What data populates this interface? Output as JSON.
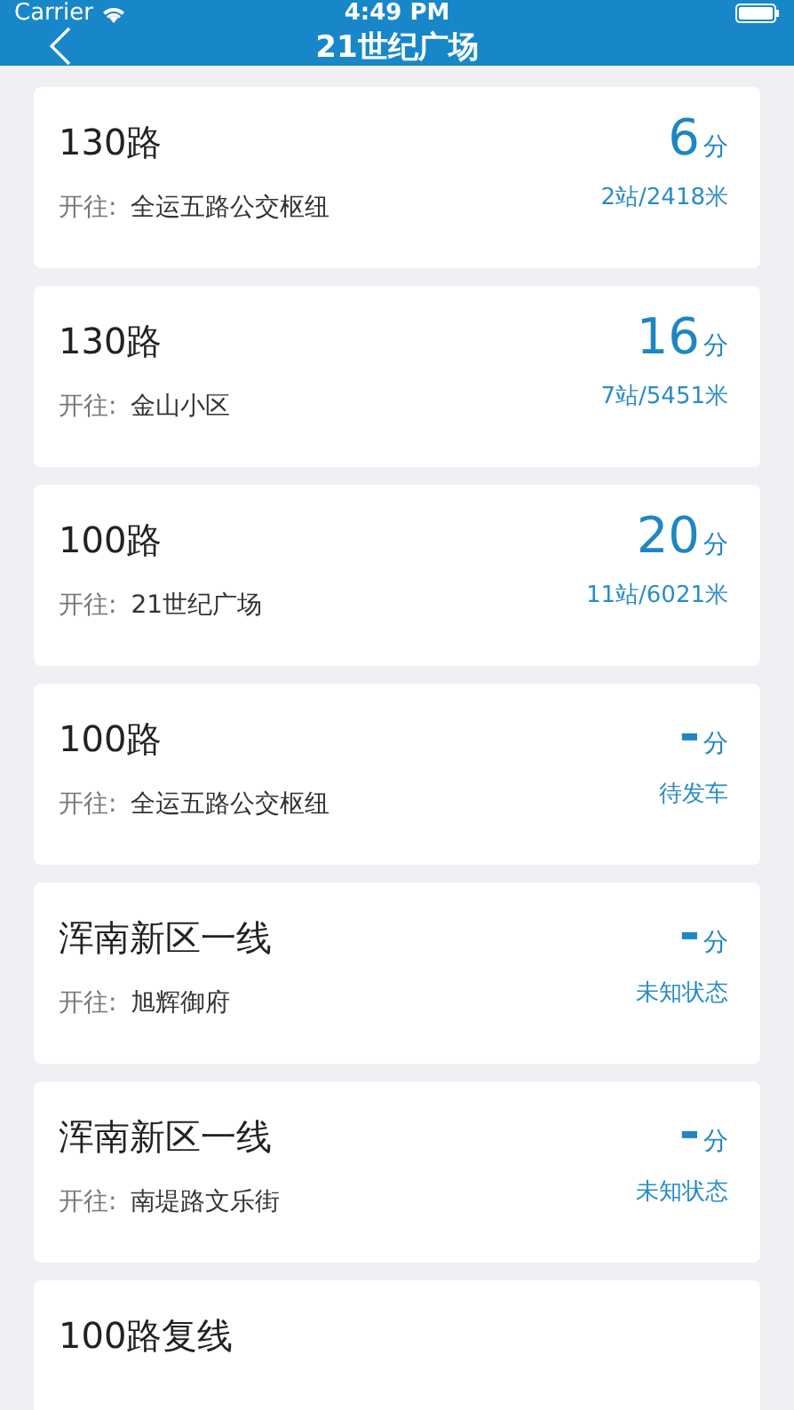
{
  "status_bar": {
    "carrier": "Carrier",
    "time": "4:49 PM"
  },
  "nav": {
    "title": "21世纪广场"
  },
  "buses": [
    {
      "route": "130路",
      "prefix": "开往:",
      "destination": "全运五路公交枢纽",
      "eta": "6",
      "unit": "分",
      "info": "2站/2418米"
    },
    {
      "route": "130路",
      "prefix": "开往:",
      "destination": "金山小区",
      "eta": "16",
      "unit": "分",
      "info": "7站/5451米"
    },
    {
      "route": "100路",
      "prefix": "开往:",
      "destination": "21世纪广场",
      "eta": "20",
      "unit": "分",
      "info": "11站/6021米"
    },
    {
      "route": "100路",
      "prefix": "开往:",
      "destination": "全运五路公交枢纽",
      "eta": "-",
      "unit": "分",
      "info": "待发车"
    },
    {
      "route": "浑南新区一线",
      "prefix": "开往:",
      "destination": "旭辉御府",
      "eta": "-",
      "unit": "分",
      "info": "未知状态"
    },
    {
      "route": "浑南新区一线",
      "prefix": "开往:",
      "destination": "南堤路文乐街",
      "eta": "-",
      "unit": "分",
      "info": "未知状态"
    },
    {
      "route": "100路复线"
    }
  ]
}
